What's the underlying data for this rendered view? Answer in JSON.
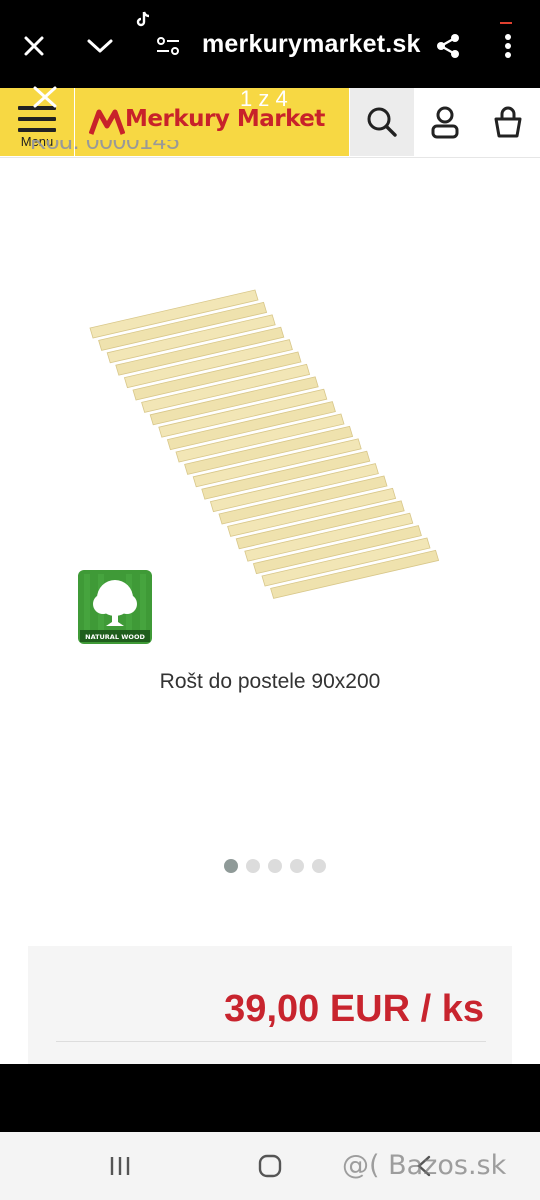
{
  "browser": {
    "url": "merkurymarket.sk",
    "icons": [
      "close-icon",
      "chevron-down-icon",
      "site-settings-icon",
      "share-icon",
      "more-vert-icon",
      "tiktok-icon"
    ]
  },
  "header": {
    "menu_label": "Menu",
    "logo_text": "Merkury Market",
    "gallery_counter": "1 z 4",
    "icons": [
      "hamburger-icon",
      "search-icon",
      "user-icon",
      "bag-icon"
    ],
    "brand_color": "#f7d843",
    "logo_color": "#c8222a"
  },
  "product": {
    "code_partial": "Kód: 0000145",
    "name": "Rošt do postele 90x200",
    "badge_text": "NATURAL WOOD",
    "price": "39,00 EUR / ks",
    "price_color": "#c8242e",
    "gallery_dots": 5,
    "active_dot": 1
  },
  "system_nav": {
    "icons": [
      "recent-apps-icon",
      "home-icon",
      "back-icon"
    ],
    "watermark": "@( Bazos.sk"
  }
}
